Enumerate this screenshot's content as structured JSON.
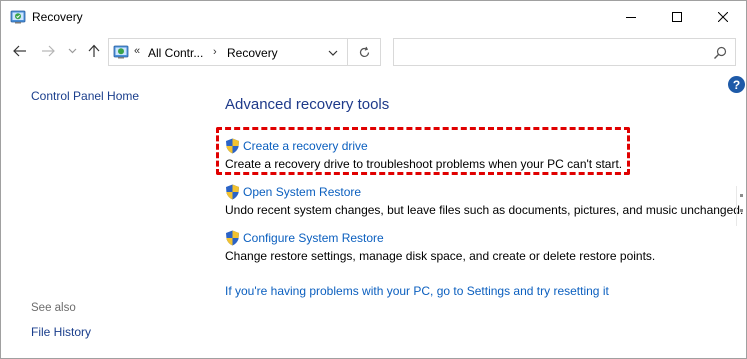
{
  "window": {
    "title": "Recovery"
  },
  "nav": {
    "breadcrumb_overflow": "«",
    "breadcrumb_parent": "All Contr...",
    "breadcrumb_separator": "›",
    "breadcrumb_current": "Recovery",
    "search_placeholder": ""
  },
  "sidebar": {
    "home_link": "Control Panel Home",
    "see_also_label": "See also",
    "see_also_links": [
      "File History"
    ]
  },
  "main": {
    "heading": "Advanced recovery tools",
    "tasks": [
      {
        "link": "Create a recovery drive",
        "description": "Create a recovery drive to troubleshoot problems when your PC can't start."
      },
      {
        "link": "Open System Restore",
        "description": "Undo recent system changes, but leave files such as documents, pictures, and music unchanged."
      },
      {
        "link": "Configure System Restore",
        "description": "Change restore settings, manage disk space, and create or delete restore points."
      }
    ],
    "reset_link": "If you're having problems with your PC, go to Settings and try resetting it"
  },
  "help": {
    "label": "?"
  },
  "colors": {
    "link": "#0b5fbf",
    "heading": "#1e3a8a",
    "highlight": "#e00000",
    "help_badge": "#1e5aa8"
  },
  "icons": {
    "app": "recovery-icon",
    "task": "shield-icon",
    "search": "search-icon",
    "refresh": "refresh-icon"
  }
}
